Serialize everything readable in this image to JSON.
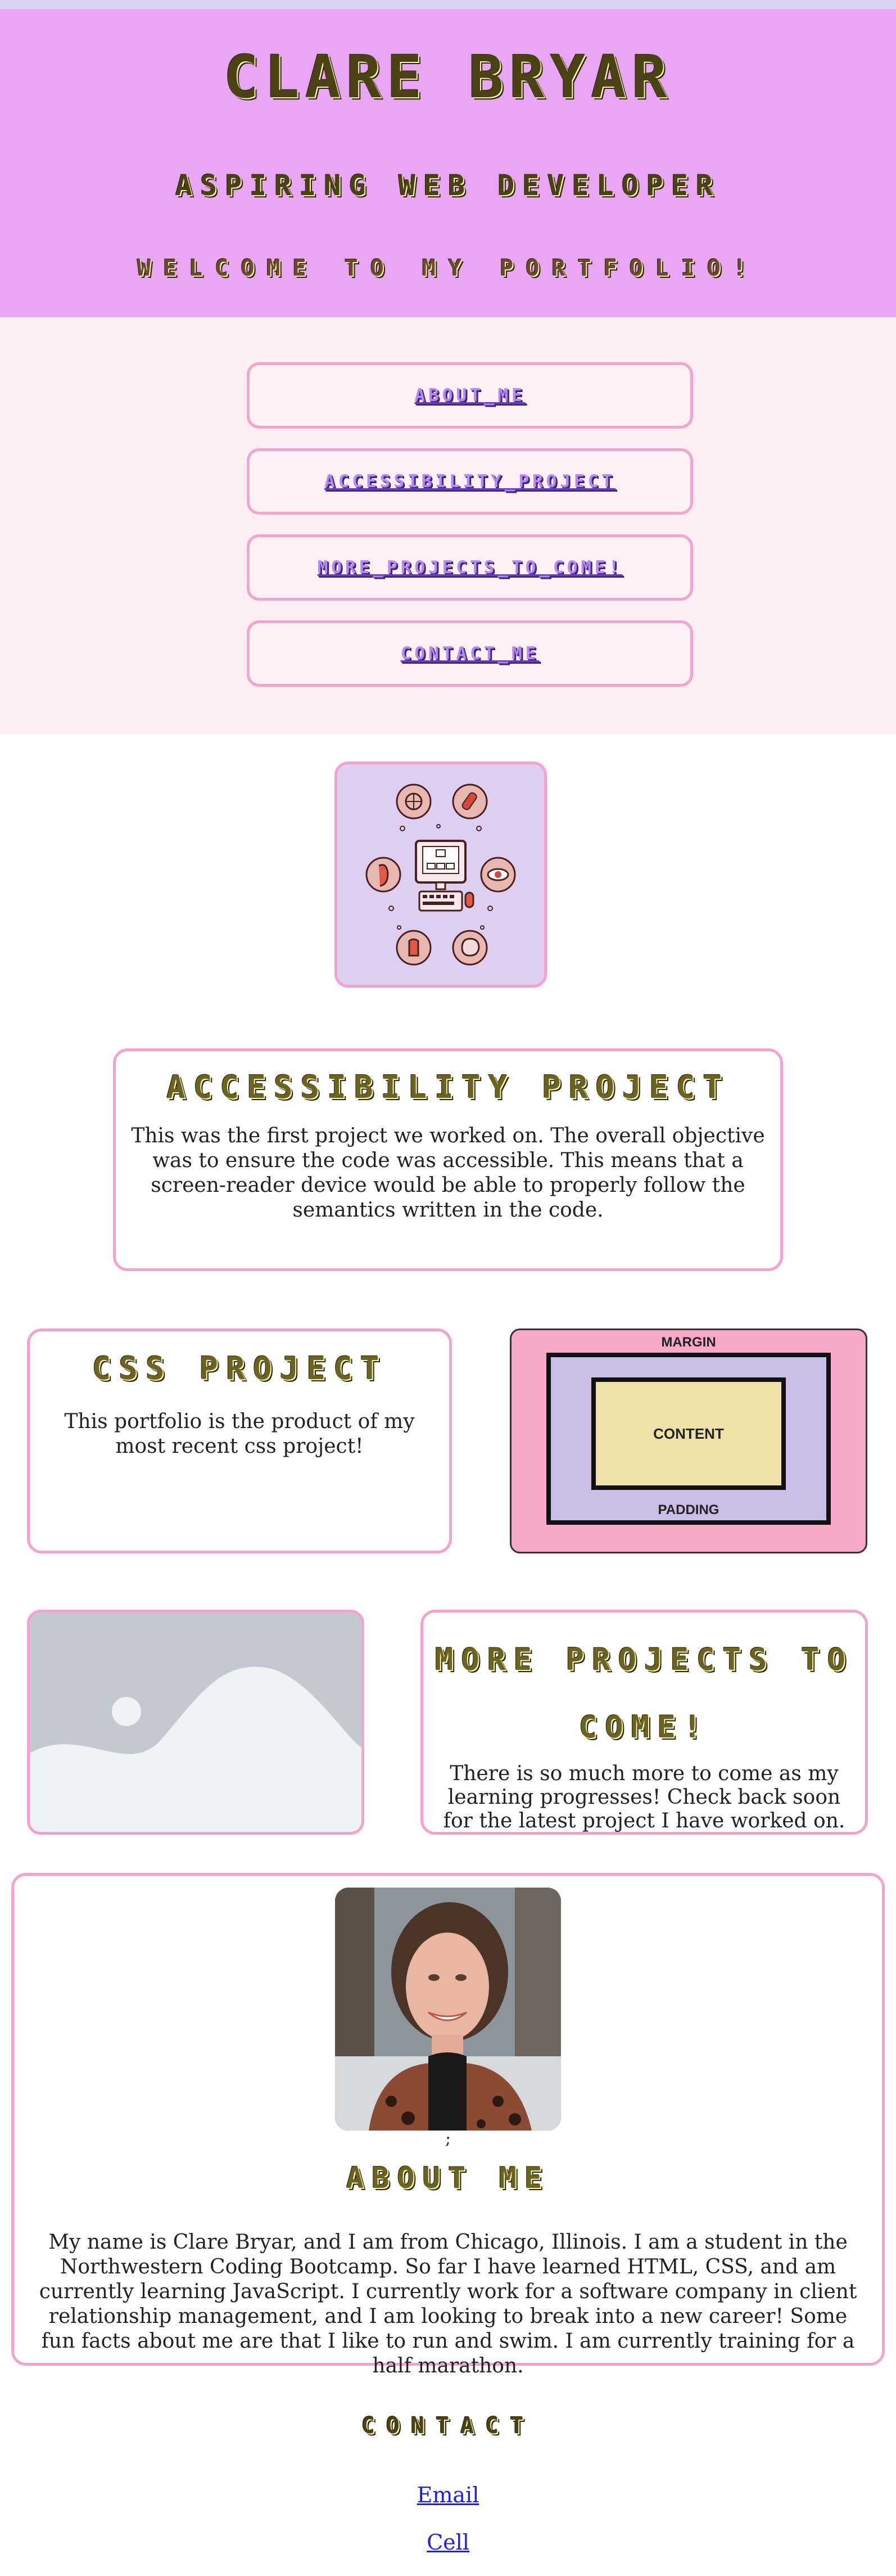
{
  "hero": {
    "name": "Clare Bryar",
    "role": "Aspiring Web Developer",
    "welcome": "Welcome to my Portfolio!"
  },
  "nav": {
    "items": [
      {
        "label": "About_Me"
      },
      {
        "label": "Accessibility_Project"
      },
      {
        "label": "More_Projects_To_Come!"
      },
      {
        "label": "Contact_Me"
      }
    ]
  },
  "accessibility": {
    "title": "Accessibility Project",
    "body": "This was the first project we worked on. The overall objective was to ensure the code was accessible. This means that a screen-reader device would be able to properly follow the semantics written in the code."
  },
  "css_project": {
    "title": "CSS Project",
    "body": "This portfolio is the product of my most recent css project!",
    "diagram": {
      "margin": "MARGIN",
      "content": "CONTENT",
      "padding": "PADDING"
    }
  },
  "more_projects": {
    "title": "More Projects To Come!",
    "body": "There is so much more to come as my learning progresses! Check back soon for the latest project I have worked on."
  },
  "about": {
    "stray": ";",
    "title": "About Me",
    "body": "My name is Clare Bryar, and I am from Chicago, Illinois. I am a student in the Northwestern Coding Bootcamp. So far I have learned HTML, CSS, and am currently learning JavaScript. I currently work for a software company in client relationship management, and I am looking to break into a new career! Some fun facts about me are that I like to run and swim. I am currently training for a half marathon."
  },
  "contact": {
    "title": "Contact",
    "email": "Email",
    "cell": "Cell"
  },
  "colors": {
    "hero_bg": "#e9a6f5",
    "nav_bg": "#fdeef4",
    "border_pink": "#f4a3cd",
    "title_olive": "#4a4215",
    "link_blue": "#1f1fe6"
  }
}
